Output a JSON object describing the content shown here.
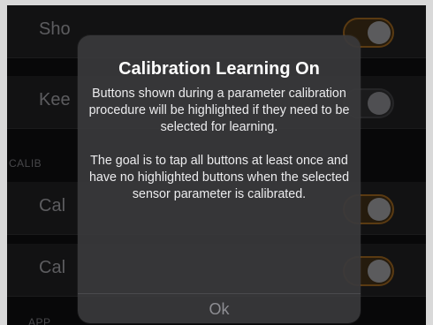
{
  "settings": {
    "rows_top": [
      {
        "label": "Sho",
        "toggle": "on"
      },
      {
        "label": "Kee",
        "toggle": "off"
      }
    ],
    "section_calib": "CALIB",
    "rows_calib": [
      {
        "label": "Cal",
        "toggle": "on"
      },
      {
        "label": "Cal",
        "toggle": "on"
      }
    ],
    "section_app": "APP"
  },
  "alert": {
    "title": "Calibration Learning On",
    "message_1": "Buttons shown during a parameter calibration procedure will be highlighted if they need to be selected for learning.",
    "message_2": "The goal is to tap all buttons at least once and have no highlighted buttons when the selected sensor parameter is calibrated.",
    "button_label": "Ok"
  }
}
